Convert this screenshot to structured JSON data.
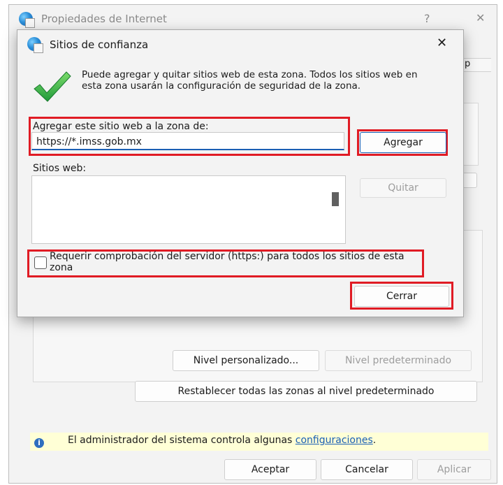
{
  "parent_window": {
    "title": "Propiedades de Internet",
    "help_icon": "?",
    "close_icon": "✕",
    "tab_fragment": "p",
    "buttons": {
      "custom_level": "Nivel personalizado...",
      "default_level": "Nivel predeterminado",
      "reset_all": "Restablecer todas las zonas al nivel predeterminado"
    },
    "info": {
      "text": "El administrador del sistema controla algunas ",
      "link": "configuraciones",
      "suffix": "."
    },
    "footer": {
      "ok": "Aceptar",
      "cancel": "Cancelar",
      "apply": "Aplicar"
    }
  },
  "dialog": {
    "title": "Sitios de confianza",
    "close_icon": "✕",
    "description": "Puede agregar y quitar sitios web de esta zona. Todos los sitios web en esta zona usarán la configuración de seguridad de la zona.",
    "add_label": "Agregar este sitio web a la zona de:",
    "add_input_value": "https://*.imss.gob.mx",
    "add_button": "Agregar",
    "sites_label": "Sitios web:",
    "remove_button": "Quitar",
    "require_https_label": "Requerir comprobación del servidor (https:) para todos los sitios de esta zona",
    "close_button": "Cerrar"
  },
  "colors": {
    "highlight": "#e01b24",
    "accent": "#1a5fb4"
  }
}
